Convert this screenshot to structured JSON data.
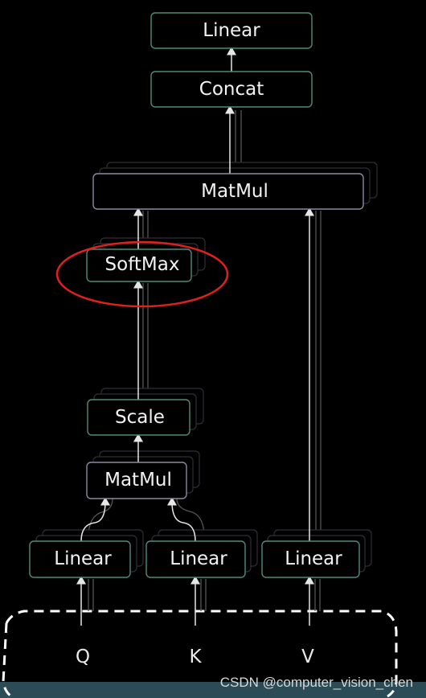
{
  "nodes": {
    "linear_out": "Linear",
    "concat": "Concat",
    "matmul_top": "MatMul",
    "softmax": "SoftMax",
    "scale": "Scale",
    "matmul_bottom": "MatMul",
    "linear_q": "Linear",
    "linear_k": "Linear",
    "linear_v": "Linear"
  },
  "inputs": [
    "Q",
    "K",
    "V"
  ],
  "highlight": {
    "target": "softmax",
    "color": "#e0201c"
  },
  "watermark": "CSDN @computer_vision_chen",
  "colors": {
    "background": "#000000",
    "linear_border": "#4f8a7c",
    "op_border": "#8a8aa0",
    "band": "#2b4b56",
    "dashed": "#ffffff"
  }
}
